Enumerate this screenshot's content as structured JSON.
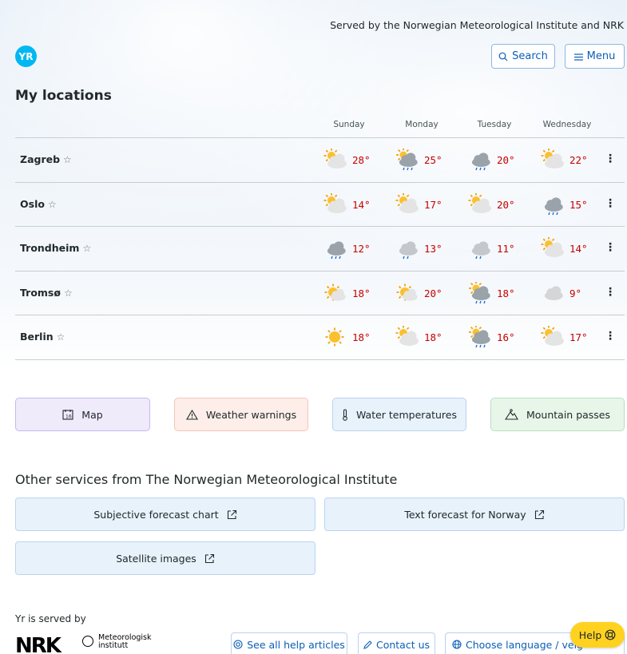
{
  "header": {
    "served_by_text": "Served by the Norwegian Meteorological Institute and NRK",
    "logo_text": "YR",
    "search_label": "Search",
    "menu_label": "Menu"
  },
  "page_title": "My locations",
  "days": [
    "Sunday",
    "Monday",
    "Tuesday",
    "Wednesday"
  ],
  "locations": [
    {
      "name": "Zagreb",
      "forecast": [
        {
          "icon": "partly-cloudy-day",
          "temp": "28°"
        },
        {
          "icon": "rain-cloud-sun",
          "temp": "25°"
        },
        {
          "icon": "rain-cloud",
          "temp": "20°"
        },
        {
          "icon": "partly-cloudy-day",
          "temp": "22°"
        }
      ]
    },
    {
      "name": "Oslo",
      "forecast": [
        {
          "icon": "partly-cloudy-day",
          "temp": "14°"
        },
        {
          "icon": "partly-cloudy-day",
          "temp": "17°"
        },
        {
          "icon": "partly-cloudy-day",
          "temp": "20°"
        },
        {
          "icon": "rain-cloud",
          "temp": "15°"
        }
      ]
    },
    {
      "name": "Trondheim",
      "forecast": [
        {
          "icon": "rain-cloud",
          "temp": "12°"
        },
        {
          "icon": "light-rain-cloud",
          "temp": "13°"
        },
        {
          "icon": "light-rain-cloud",
          "temp": "11°"
        },
        {
          "icon": "partly-cloudy-day",
          "temp": "14°"
        }
      ]
    },
    {
      "name": "Tromsø",
      "forecast": [
        {
          "icon": "fair-day",
          "temp": "18°"
        },
        {
          "icon": "fair-day",
          "temp": "20°"
        },
        {
          "icon": "rain-cloud-sun",
          "temp": "18°"
        },
        {
          "icon": "cloudy",
          "temp": "9°"
        }
      ]
    },
    {
      "name": "Berlin",
      "forecast": [
        {
          "icon": "clear-sun",
          "temp": "18°"
        },
        {
          "icon": "partly-cloudy-day",
          "temp": "18°"
        },
        {
          "icon": "rain-cloud-sun",
          "temp": "16°"
        },
        {
          "icon": "partly-cloudy-day",
          "temp": "17°"
        }
      ]
    }
  ],
  "tiles": {
    "map": "Map",
    "warnings": "Weather warnings",
    "water": "Water temperatures",
    "mountain": "Mountain passes"
  },
  "other_services": {
    "title": "Other services from The Norwegian Meteorological Institute",
    "items": [
      "Subjective forecast chart",
      "Text forecast for Norway",
      "Satellite images"
    ]
  },
  "footer": {
    "served_by": "Yr is served by",
    "nrk_logo": "NRK",
    "met_logo_line1": "Meteorologisk",
    "met_logo_line2": "institutt",
    "help_articles": "See all help articles",
    "contact": "Contact us",
    "language": "Choose language / velg",
    "help": "Help"
  },
  "colors": {
    "accent_blue": "#0a5eb8",
    "temp_warm": "#c60000",
    "logo": "#00b8f1",
    "help_yellow": "#ffd21f"
  }
}
